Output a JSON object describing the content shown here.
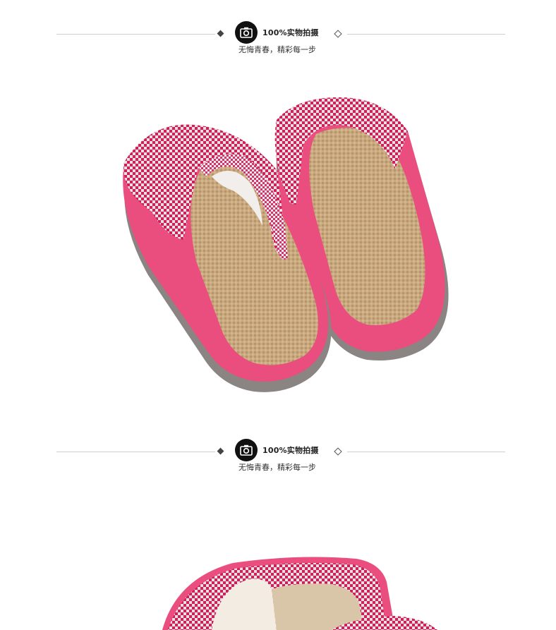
{
  "sections": [
    {
      "title": "100%实物拍摄",
      "subtitle": "无悔青春，精彩每一步",
      "camera_icon": "camera-icon"
    },
    {
      "title": "100%实物拍摄",
      "subtitle": "无悔青春，精彩每一步",
      "camera_icon": "camera-icon"
    }
  ],
  "colors": {
    "slipper_pink": "#e94e7e",
    "checker_red": "#c8245a",
    "jute_tan": "#c7a67c",
    "sole_grey": "#8a8583"
  }
}
